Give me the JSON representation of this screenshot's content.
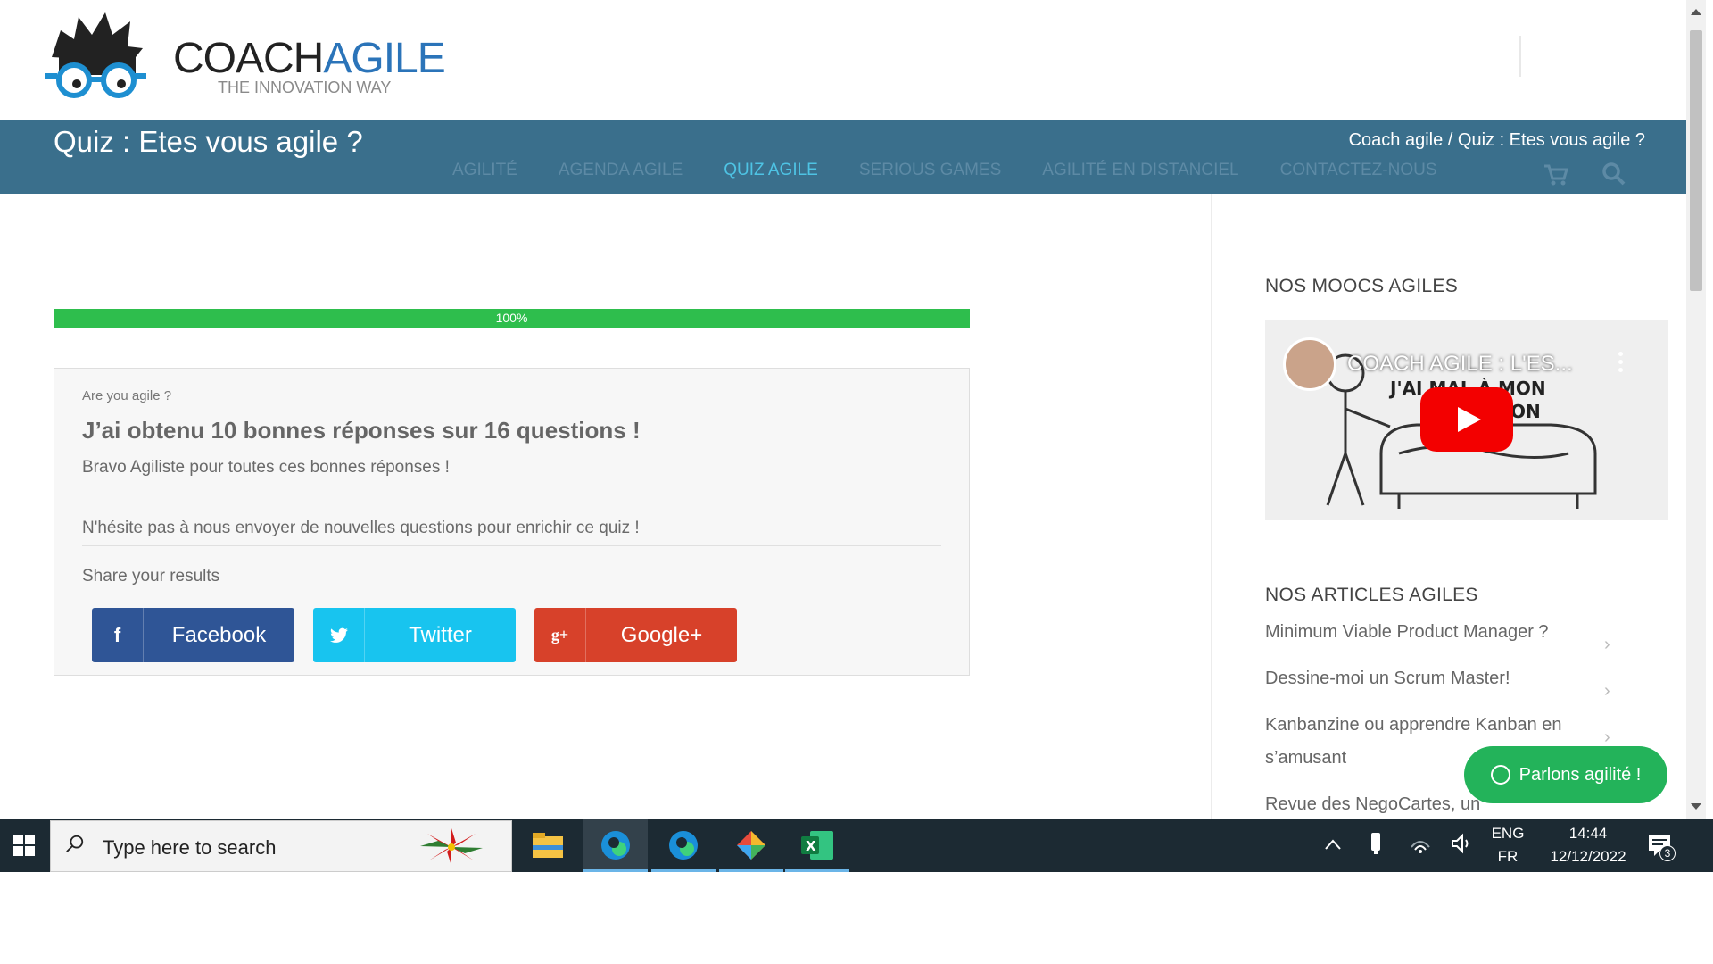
{
  "header": {
    "logo_word1": "COACH",
    "logo_word2": "AGILE",
    "logo_tagline": "THE INNOVATION WAY",
    "page_title": "Quiz : Etes vous agile ?",
    "breadcrumb": "Coach agile / Quiz : Etes vous agile ?",
    "nav": [
      {
        "label": "AGILITÉ",
        "active": false
      },
      {
        "label": "AGENDA AGILE",
        "active": false
      },
      {
        "label": "QUIZ AGILE",
        "active": true
      },
      {
        "label": "SERIOUS GAMES",
        "active": false
      },
      {
        "label": "AGILITÉ EN DISTANCIEL",
        "active": false
      },
      {
        "label": "CONTACTEZ-NOUS",
        "active": false
      }
    ],
    "cart_icon": "cart-icon",
    "search_icon": "search-icon"
  },
  "quiz": {
    "progress_percent": 100,
    "progress_label": "100%",
    "label": "Are you agile ?",
    "result": "J’ai obtenu 10 bonnes réponses sur 16 questions !",
    "bravo": "Bravo Agiliste pour toutes ces bonnes réponses !",
    "invite": "N'hésite pas à nous envoyer de nouvelles questions pour enrichir ce quiz !",
    "share_label": "Share your results",
    "share_buttons": [
      {
        "label": "Facebook",
        "icon": "f",
        "color": "#2f5596"
      },
      {
        "label": "Twitter",
        "icon": "twitter-bird",
        "color": "#18c4ef"
      },
      {
        "label": "Google+",
        "icon": "g+",
        "color": "#d7412a"
      }
    ]
  },
  "sidebar": {
    "moocs_heading": "NOS MOOCS AGILES",
    "video_title": "COACH AGILE : L'ES...",
    "video_caption_1": "J'AI MAL À MON",
    "video_caption_2": "ON",
    "articles_heading": "NOS ARTICLES AGILES",
    "articles": [
      "Minimum Viable Product Manager ?",
      "Dessine-moi un Scrum Master!",
      "Kanbanzine ou apprendre Kanban en s’amusant",
      "Revue des NegoCartes, un"
    ],
    "chat_label": "Parlons agilité !"
  },
  "taskbar": {
    "search_placeholder": "Type here to search",
    "lang_top": "ENG",
    "lang_bottom": "FR",
    "time": "14:44",
    "date": "12/12/2022",
    "notifications": "3"
  },
  "colors": {
    "title_bar": "#3a6f8c",
    "nav_active": "#4ec3e4",
    "progress": "#2ebe4d",
    "chat": "#23b35a"
  }
}
